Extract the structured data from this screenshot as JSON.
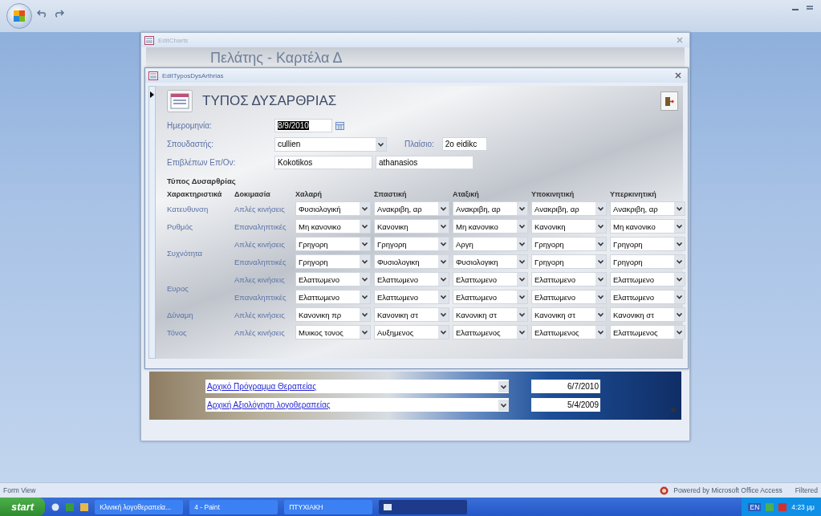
{
  "background_window": {
    "title": "EditCharts",
    "heading": "Πελάτης - Καρτέλα Δ"
  },
  "window": {
    "title": "EditTyposDysArthrias",
    "heading": "ΤΥΠΟΣ ΔΥΣΑΡΘΡΙΑΣ"
  },
  "fields": {
    "date": {
      "label": "Ημερομηνία:",
      "value": "8/9/2010",
      "highlighted": true
    },
    "student": {
      "label": "Σπουδαστής:",
      "value": "cullien"
    },
    "frame": {
      "label": "Πλαίσιο:",
      "value": "2o eidikc"
    },
    "supervisor": {
      "label": "Επιβλέπων Επ/Ον:",
      "values": [
        "Kokotikos",
        "athanasios"
      ]
    }
  },
  "section_title": "Τύπος Δυσαρθρίας",
  "grid": {
    "columns": [
      "Χαρακτηριστικά",
      "Δοκιμασία",
      "Χαλαρή",
      "Σπαστική",
      "Αταξική",
      "Υποκινητική",
      "Υπερκινητική"
    ],
    "groups": [
      {
        "characteristic": "Κατευθυνση",
        "tests": [
          {
            "test": "Απλές κινήσεις",
            "values": [
              "Φυσιολογική",
              "Ανακριβη, αρ",
              "Ανακριβη, αρ",
              "Ανακριβη, αρ",
              "Ανακριβη, αρ"
            ]
          }
        ]
      },
      {
        "characteristic": "Ρυθμός",
        "tests": [
          {
            "test": "Επαναληπτικές",
            "values": [
              "Μη κανονικο",
              "Κανονικη",
              "Μη κανονικο",
              "Κανονικη",
              "Μη κανονικο"
            ]
          }
        ]
      },
      {
        "characteristic": "Συχνότητα",
        "tests": [
          {
            "test": "Απλές κινήσεις",
            "values": [
              "Γρηγορη",
              "Γρηγορη",
              "Αργη",
              "Γρηγορη",
              "Γρηγορη"
            ]
          },
          {
            "test": "Επαναληπτικές",
            "values": [
              "Γρηγορη",
              "Φυσιολογικη",
              "Φυσιολογικη",
              "Γρηγορη",
              "Γρηγορη"
            ]
          }
        ]
      },
      {
        "characteristic": "Ευρος",
        "tests": [
          {
            "test": "Απλες κινήσεις",
            "values": [
              "Ελαττωμενο",
              "Ελαττωμενο",
              "Ελαττωμενο",
              "Ελαττωμενο",
              "Ελαττωμενο"
            ]
          },
          {
            "test": "Επαναληπτικές",
            "values": [
              "Ελαττωμενο",
              "Ελαττωμενο",
              "Ελαττωμενο",
              "Ελαττωμενο",
              "Ελαττωμενο"
            ]
          }
        ]
      },
      {
        "characteristic": "Δύναμη",
        "tests": [
          {
            "test": "Απλές κινήσεις",
            "values": [
              "Κανονικη πρ",
              "Κανονικη στ",
              "Κανονικη στ",
              "Κανονικη στ",
              "Κανονικη στ"
            ]
          }
        ]
      },
      {
        "characteristic": "Τόνος",
        "tests": [
          {
            "test": "Απλές κινήσεις",
            "values": [
              "Μυικος τονος",
              "Αυξημενος",
              "Ελαττωμενος",
              "Ελαττωμενος",
              "Ελαττωμενος"
            ]
          }
        ]
      }
    ]
  },
  "subform": {
    "rows": [
      {
        "link": "Αρχικό Πρόγραμμα Θεραπείας",
        "date": "6/7/2010"
      },
      {
        "link": "Αρχική Αξιολόγηση λογοθεραπείας",
        "date": "5/4/2009"
      }
    ]
  },
  "status_bar": {
    "view": "Form View",
    "powered": "Powered by Microsoft Office Access",
    "filter": "Filtered"
  },
  "taskbar": {
    "start": "start",
    "tasks": [
      {
        "label": "Κλινική λογοθεραπεία..."
      },
      {
        "label": "4 - Paint"
      },
      {
        "label": "ΠΤΥΧΙΑΚΗ"
      }
    ],
    "language": "EN",
    "clock": "4:23 μμ"
  }
}
